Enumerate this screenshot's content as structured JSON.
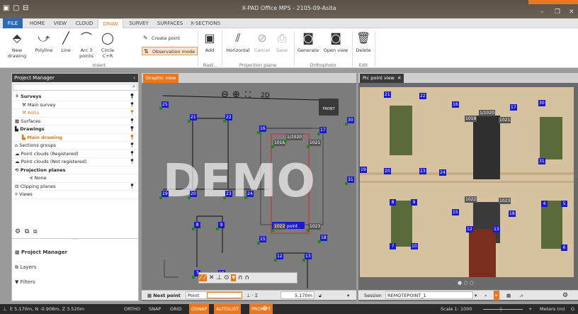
{
  "title": "X-PAD Office MPS - 2105-09-Asita",
  "menu": [
    "FILE",
    "HOME",
    "VIEW",
    "CLOUD",
    "DRAW",
    "SURVEY",
    "SURFACES",
    "X-SECTIONS"
  ],
  "active_menu": "DRAW",
  "ribbon": {
    "insert": {
      "group": "Insert",
      "buttons": [
        "New drawing",
        "Polyline",
        "Line",
        "Arc 3 points",
        "Circle C+R"
      ]
    },
    "create_point": "Create point",
    "observation_mode": "Observation mode",
    "rast": {
      "group": "Rast...",
      "button": "Add"
    },
    "projection": {
      "group": "Projection plane",
      "buttons": [
        "Horizontal",
        "Cancel",
        "Save"
      ]
    },
    "orthophoto": {
      "group": "Orthophoto",
      "buttons": [
        "Generate",
        "Open view"
      ]
    },
    "edit": {
      "group": "Edit",
      "buttons": [
        "Delete"
      ]
    }
  },
  "project_manager": {
    "title": "Project Manager",
    "tree": [
      {
        "label": "Surveys",
        "level": 0,
        "bold": true
      },
      {
        "label": "Main survey",
        "level": 1
      },
      {
        "label": "Asita",
        "level": 1,
        "orange": true
      },
      {
        "label": "Surfaces",
        "level": 0
      },
      {
        "label": "Drawings",
        "level": 0,
        "bold": true
      },
      {
        "label": "Main drawing",
        "level": 1,
        "orange": true,
        "bold": true
      },
      {
        "label": "Sections groups",
        "level": 0
      },
      {
        "label": "Point clouds (Registered)",
        "level": 0
      },
      {
        "label": "Point clouds (Not registered)",
        "level": 0
      },
      {
        "label": "Projection planes",
        "level": 0,
        "bold": true
      },
      {
        "label": "None",
        "level": 2
      },
      {
        "label": "Clipping planes",
        "level": 0
      },
      {
        "label": "Views",
        "level": 0
      }
    ],
    "nav": [
      "Project Manager",
      "Layers",
      "Filters"
    ]
  },
  "graphic_view": {
    "tab": "Graphic view",
    "watermark": "DEMO",
    "front_label": "FRONT",
    "toolbar_2d": "2D",
    "next_point_label": "Next point",
    "cursor_tooltip": "Next point",
    "point_field_label": "Point",
    "distance_value": "5.170m",
    "points": [
      "25",
      "21",
      "22",
      "16",
      "17",
      "1018",
      "1/1020",
      "1021",
      "19",
      "20",
      "23",
      "24",
      "8",
      "9",
      "1022",
      "1023",
      "15",
      "18",
      "12",
      "13",
      "7",
      "10",
      "30",
      "31"
    ]
  },
  "pic_view": {
    "tab": "Pic point view",
    "session_label": "Session",
    "session_value": "REMOTEPOINT_1",
    "points": [
      "21",
      "22",
      "16",
      "17",
      "30",
      "1018",
      "1/1020",
      "1021",
      "31",
      "19",
      "20",
      "23",
      "24",
      "1022",
      "1023",
      "8",
      "9",
      "15",
      "18",
      "4",
      "5",
      "12",
      "13",
      "7",
      "10",
      "6"
    ]
  },
  "status": {
    "coords": "E 5.170m, N -0.908m, Z 3.520m",
    "toggles": [
      {
        "label": "ORTHO",
        "on": false
      },
      {
        "label": "SNAP",
        "on": false
      },
      {
        "label": "GRID",
        "on": false
      },
      {
        "label": "OSNAP",
        "on": true
      },
      {
        "label": "AUTOLIST",
        "on": true
      },
      {
        "label": "PROMPT",
        "on": true
      }
    ],
    "scale": "Scale 1: 1000",
    "units": "Meters (m)",
    "units_tail": "G"
  }
}
